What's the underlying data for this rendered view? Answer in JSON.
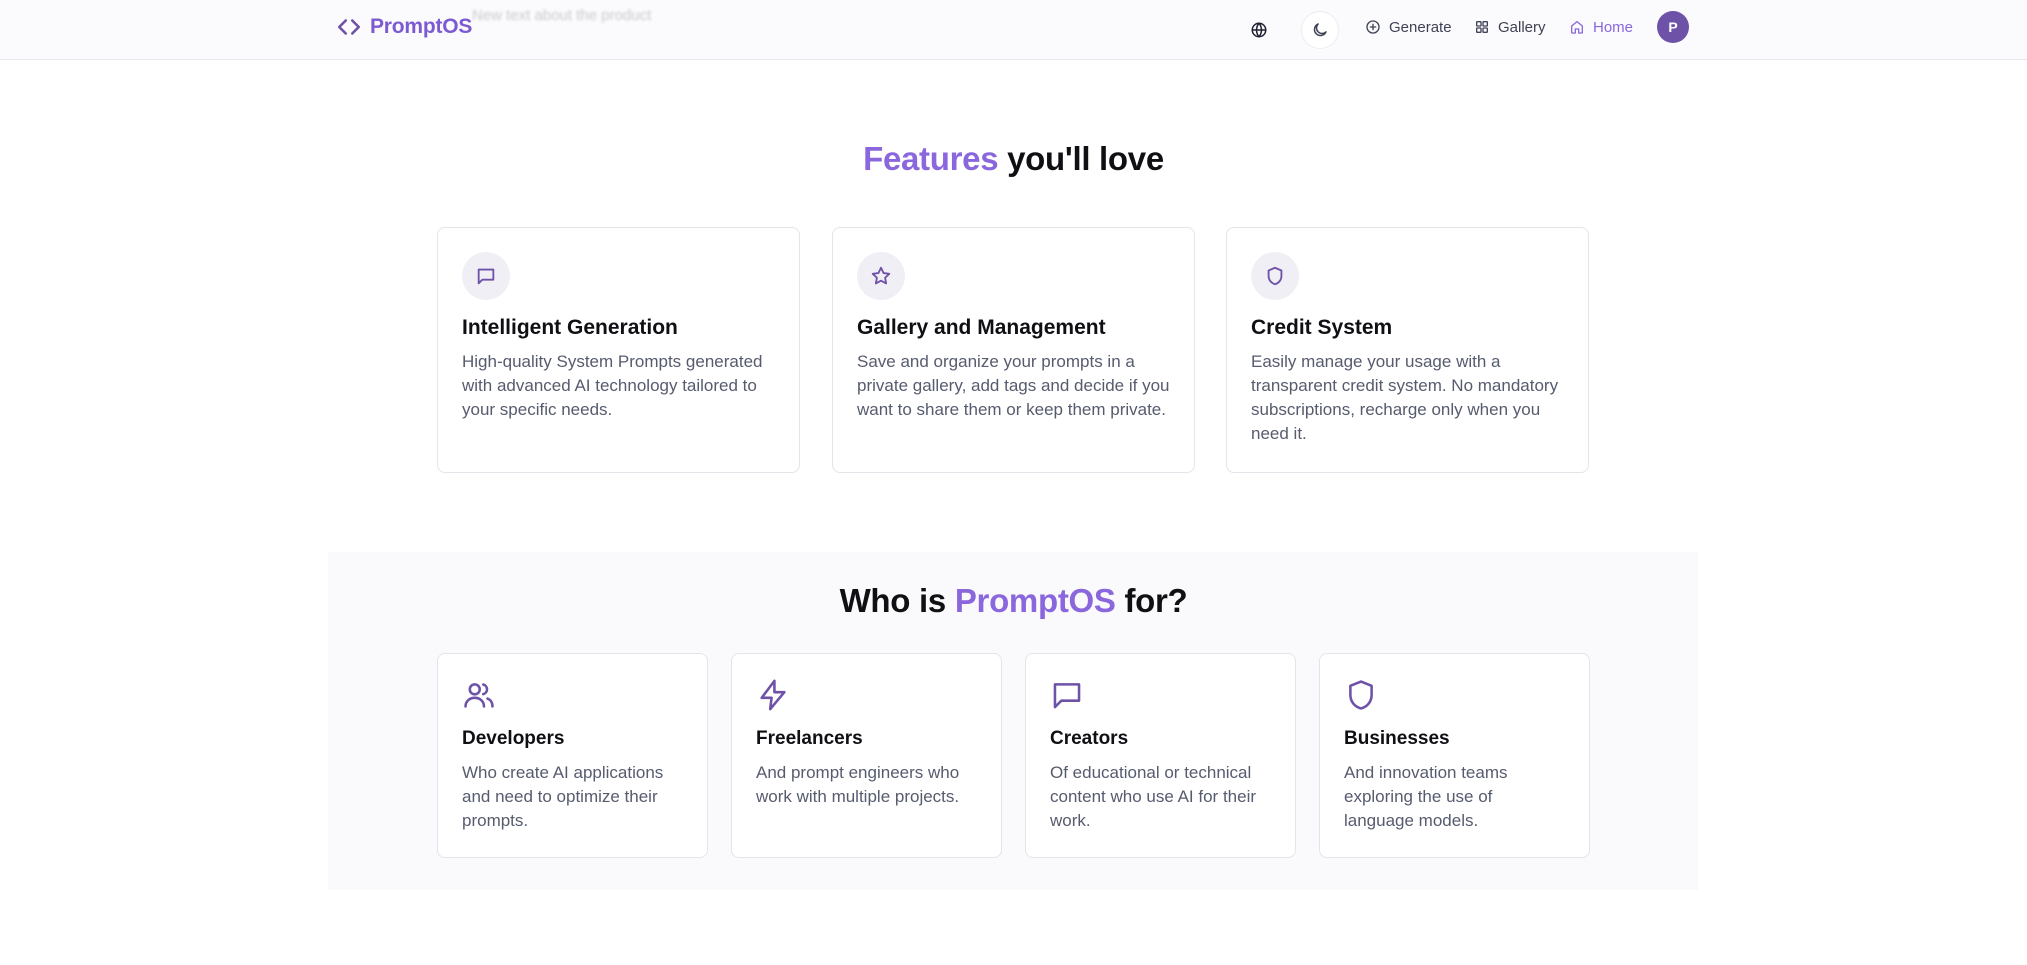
{
  "nav": {
    "faded_text": "New text about the product",
    "brand": "PromptOS",
    "links": [
      {
        "label": "Generate",
        "icon": "plus-circle-icon"
      },
      {
        "label": "Gallery",
        "icon": "grid-icon"
      },
      {
        "label": "Home",
        "icon": "home-icon"
      }
    ],
    "avatar_initial": "P"
  },
  "features": {
    "title_accent": "Features",
    "title_rest": " you'll love",
    "cards": [
      {
        "icon": "message-square-icon",
        "title": "Intelligent Generation",
        "desc": "High-quality System Prompts generated with advanced AI technology tailored to your specific needs."
      },
      {
        "icon": "star-icon",
        "title": "Gallery and Management",
        "desc": "Save and organize your prompts in a private gallery, add tags and decide if you want to share them or keep them private."
      },
      {
        "icon": "shield-icon",
        "title": "Credit System",
        "desc": "Easily manage your usage with a transparent credit system. No mandatory subscriptions, recharge only when you need it."
      }
    ]
  },
  "audience": {
    "title_pre": "Who is ",
    "title_accent": "PromptOS",
    "title_post": " for?",
    "cards": [
      {
        "icon": "users-icon",
        "title": "Developers",
        "desc": "Who create AI applications and need to optimize their prompts."
      },
      {
        "icon": "zap-icon",
        "title": "Freelancers",
        "desc": "And prompt engineers who work with multiple projects."
      },
      {
        "icon": "message-square-icon",
        "title": "Creators",
        "desc": "Of educational or technical content who use AI for their work."
      },
      {
        "icon": "shield-icon",
        "title": "Businesses",
        "desc": "And innovation teams exploring the use of language models."
      }
    ]
  },
  "colors": {
    "accent": "#8a67dc",
    "brand": "#7c5bd2",
    "icon": "#6e52a7",
    "text_muted": "#565b6e"
  }
}
